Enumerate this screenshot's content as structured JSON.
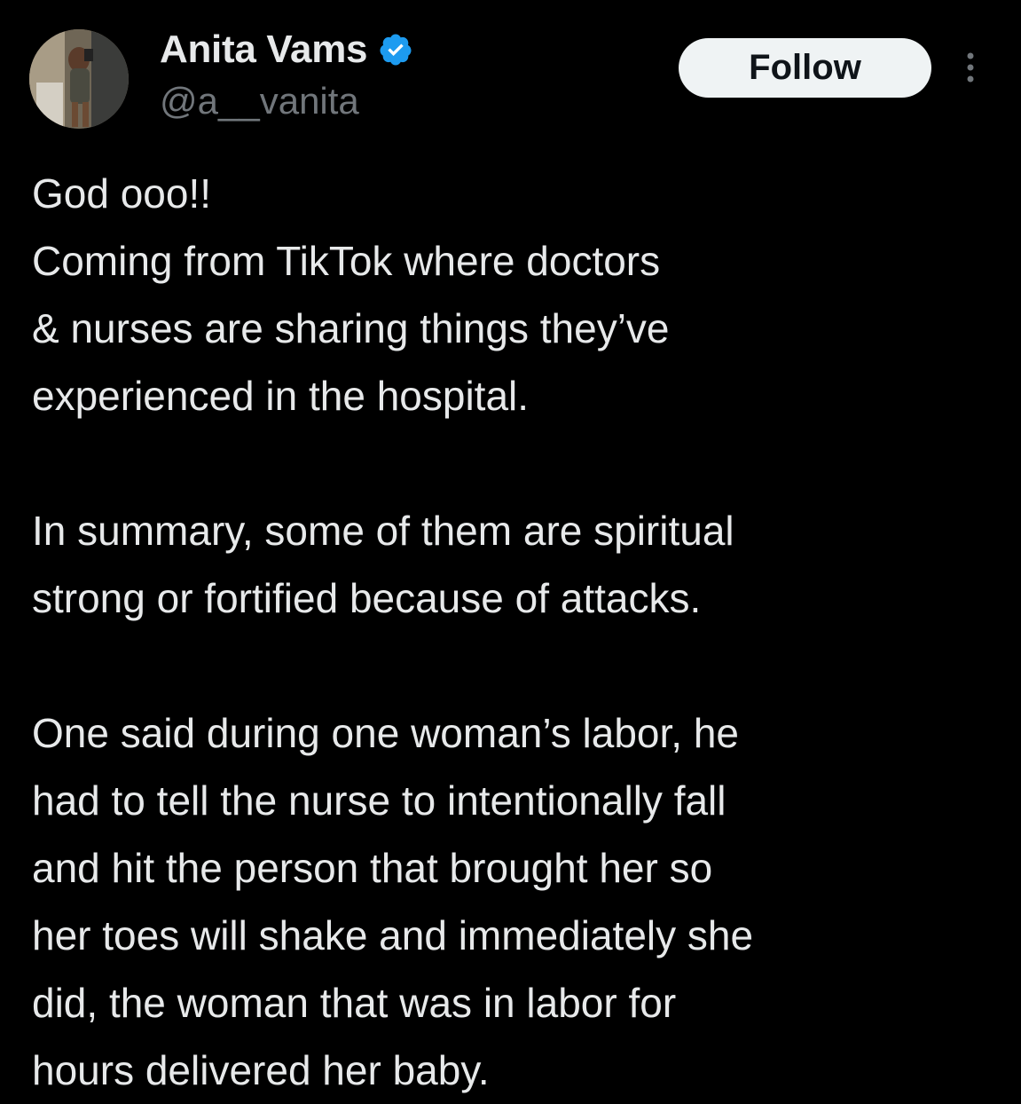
{
  "author": {
    "display_name": "Anita Vams",
    "handle": "@a__vanita",
    "verified_icon": "verified-badge-icon",
    "avatar_icon": "profile-photo"
  },
  "actions": {
    "follow_label": "Follow",
    "more_icon": "more-vertical-icon"
  },
  "colors": {
    "background": "#000000",
    "text_primary": "#e7e9ea",
    "text_secondary": "#71767b",
    "verified_blue": "#1d9bf0",
    "follow_bg": "#eff3f4",
    "follow_text": "#0f1419"
  },
  "tweet": {
    "paragraphs": [
      {
        "lines": [
          "God ooo!!",
          "Coming from TikTok where doctors",
          "& nurses are sharing things they’ve",
          "experienced in the hospital."
        ]
      },
      {
        "lines": [
          "In summary, some of them are spiritual",
          "strong or fortified because of attacks."
        ]
      },
      {
        "lines": [
          "One said during one woman’s labor, he",
          "had to tell the nurse to intentionally fall",
          "and hit the person that brought her so",
          "her toes will shake and immediately she",
          "did, the woman that was in labor for",
          "hours delivered her baby."
        ]
      }
    ]
  }
}
